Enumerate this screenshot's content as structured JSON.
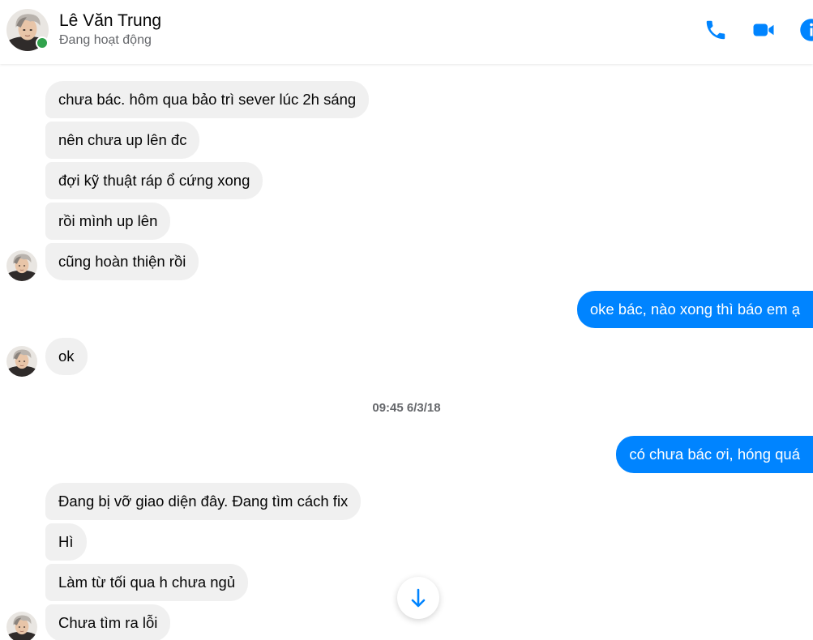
{
  "header": {
    "name": "Lê Văn Trung",
    "status": "Đang hoạt động",
    "icons": [
      "phone-icon",
      "video-icon",
      "info-icon"
    ],
    "accent_color": "#0084ff",
    "online_color": "#31a24c"
  },
  "messages": [
    {
      "from": "them",
      "text": "chưa bác. hôm qua bảo trì sever lúc 2h sáng"
    },
    {
      "from": "them",
      "text": "nên chưa up lên đc"
    },
    {
      "from": "them",
      "text": "đợi kỹ thuật ráp ổ cứng xong"
    },
    {
      "from": "them",
      "text": "rồi mình up lên"
    },
    {
      "from": "them",
      "text": "cũng hoàn thiện rồi"
    },
    {
      "from": "me",
      "text": "oke bác, nào xong thì báo em ạ"
    },
    {
      "from": "them",
      "text": "ok"
    },
    {
      "from": "me",
      "text": "có chưa bác ơi, hóng quá"
    },
    {
      "from": "them",
      "text": "Đang bị vỡ giao diện đây. Đang tìm cách fix"
    },
    {
      "from": "them",
      "text": "Hì"
    },
    {
      "from": "them",
      "text": "Làm từ tối qua h chưa ngủ"
    },
    {
      "from": "them",
      "text": "Chưa tìm ra lỗi"
    }
  ],
  "timestamp": "09:45 6/3/18",
  "scroll_button_icon": "arrow-down-icon"
}
